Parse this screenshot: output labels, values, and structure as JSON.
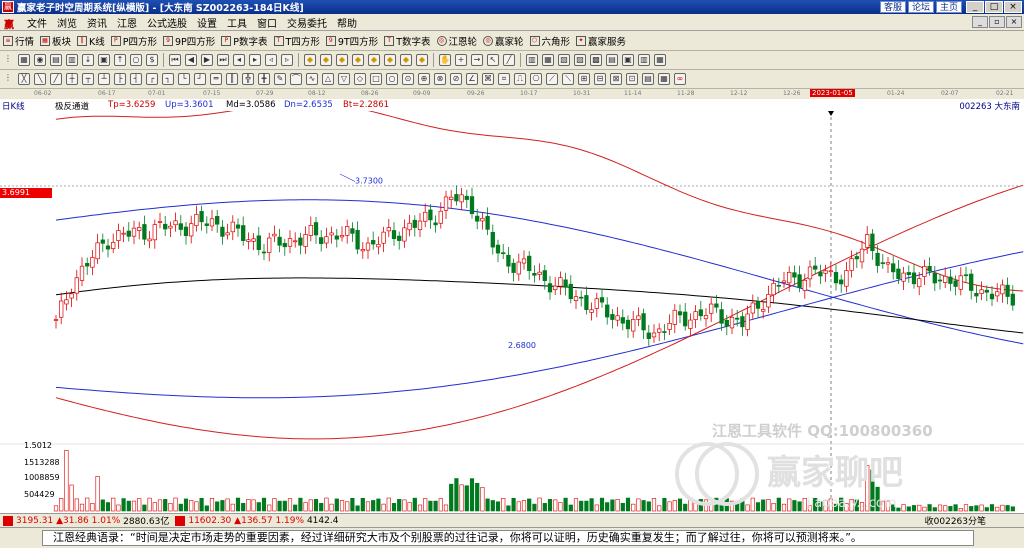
{
  "window": {
    "title": "赢家老子时空周期系统[纵横版] - [大东南  SZ002263-184日K线]",
    "links": [
      "客服",
      "论坛",
      "主页"
    ]
  },
  "menu": [
    "文件",
    "浏览",
    "资讯",
    "江恩",
    "公式选股",
    "设置",
    "工具",
    "窗口",
    "交易委托",
    "帮助"
  ],
  "toolbar": [
    {
      "icon": "list-icon",
      "label": "行情"
    },
    {
      "icon": "grid-icon",
      "label": "板块"
    },
    {
      "icon": "kline-icon",
      "label": "K线"
    },
    {
      "icon": "square-p-icon",
      "label": "P四方形"
    },
    {
      "icon": "square-9p-icon",
      "label": "9P四方形"
    },
    {
      "icon": "square-pn-icon",
      "label": "P数字表"
    },
    {
      "icon": "square-t-icon",
      "label": "T四方形"
    },
    {
      "icon": "square-9t-icon",
      "label": "9T四方形"
    },
    {
      "icon": "square-tn-icon",
      "label": "T数字表"
    },
    {
      "icon": "gann-wheel-icon",
      "label": "江恩轮"
    },
    {
      "icon": "winner-wheel-icon",
      "label": "赢家轮"
    },
    {
      "icon": "hexagon-icon",
      "label": "六角形"
    },
    {
      "icon": "service-icon",
      "label": "赢家服务"
    }
  ],
  "chart_header": {
    "period": "日K线",
    "indicator": "极反通道",
    "tp": "Tp=3.6259",
    "up": "Up=3.3601",
    "md": "Md=3.0586",
    "dn": "Dn=2.6535",
    "bt": "Bt=2.2861",
    "stock": "002263  大东南"
  },
  "cursor_price": "3.6991",
  "annotations": {
    "high": "3.7300",
    "low": "2.6800"
  },
  "date_axis": [
    "06-02",
    "06-17",
    "07-01",
    "07-15",
    "07-29",
    "08-12",
    "08-26",
    "09-09",
    "09-26",
    "10-17",
    "10-31",
    "11-14",
    "11-28",
    "12-12",
    "12-26",
    "2023-01-05",
    "01-24",
    "02-07",
    "02-21"
  ],
  "volume_axis": [
    "1.5012",
    "1513288",
    "1008859",
    "504429"
  ],
  "watermark": {
    "line1": "江恩工具软件    QQ:100800360",
    "line2": "赢家聊吧",
    "line3": "jiaoba.y...com"
  },
  "status": {
    "sh_index": "3195.31",
    "sh_change": "31.86",
    "sh_pct": "1.01%",
    "sh_amount": "2880.63亿",
    "sz_index": "11602.30",
    "sz_change": "136.57",
    "sz_pct": "1.19%",
    "sz_amount": "4142.4",
    "right_text": "收002263分笔"
  },
  "quote": "江恩经典语录：“时间是决定市场走势的重要因素，经过详细研究大市及个别股票的过往记录，你将可以证明，历史确实重复发生；而了解过往，你将可以预测将来。”。",
  "colors": {
    "up": "#e00000",
    "down": "#007a1e",
    "outer_band": "#d22020",
    "inner_band": "#1f2fd2",
    "mid_line": "#000000"
  },
  "chart_data": {
    "type": "line",
    "title": "",
    "indicator": "极反通道",
    "xlim": [
      0,
      196
    ],
    "ylim": [
      2.0,
      4.2
    ],
    "series": [
      {
        "name": "Tp",
        "values": []
      },
      {
        "name": "Up",
        "values": []
      },
      {
        "name": "Md",
        "values": []
      },
      {
        "name": "Dn",
        "values": []
      },
      {
        "name": "Bt",
        "values": []
      }
    ],
    "candles": [],
    "volume_max": 1.5012,
    "latest": {
      "Tp": 3.6259,
      "Up": 3.3601,
      "Md": 3.0586,
      "Dn": 2.6535,
      "Bt": 2.2861
    },
    "high": 3.73,
    "low": 2.68
  }
}
